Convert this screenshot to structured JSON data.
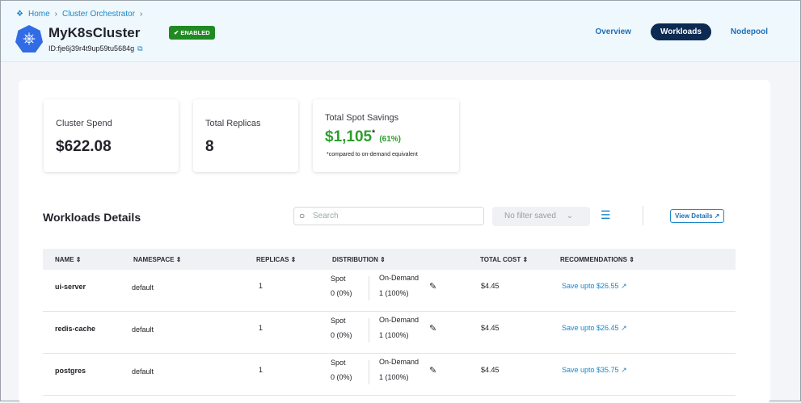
{
  "breadcrumb": {
    "home": "Home",
    "section": "Cluster Orchestrator"
  },
  "cluster": {
    "name": "MyK8sCluster",
    "id": "ID:fje6j39r4t9up59tu5684g",
    "status": "ENABLED"
  },
  "nav": [
    "Overview",
    "Workloads",
    "Nodepool"
  ],
  "stats": {
    "spend_label": "Cluster Spend",
    "spend": "$622.08",
    "replicas_label": "Total Replicas",
    "replicas": "8",
    "savings_label": "Total Spot Savings",
    "savings": "$1,105",
    "savings_mark": "*",
    "savings_pct": "(61%)",
    "savings_note": "*compared to on-demand equivalent"
  },
  "workloads": {
    "title": "Workloads Details",
    "search_placeholder": "Search",
    "filter": "No filter saved",
    "view_details": "View Details",
    "columns": [
      "NAME",
      "NAMESPACE",
      "REPLICAS",
      "DISTRIBUTION",
      "TOTAL COST",
      "RECOMMENDATIONS"
    ],
    "spot_label": "Spot",
    "ondemand_label": "On-Demand",
    "rows": [
      {
        "name": "ui-server",
        "namespace": "default",
        "replicas": "1",
        "spot": "0 (0%)",
        "ondemand": "1 (100%)",
        "cost": "$4.45",
        "rec": "Save upto $26.55"
      },
      {
        "name": "redis-cache",
        "namespace": "default",
        "replicas": "1",
        "spot": "0 (0%)",
        "ondemand": "1 (100%)",
        "cost": "$4.45",
        "rec": "Save upto $26.45"
      },
      {
        "name": "postgres",
        "namespace": "default",
        "replicas": "1",
        "spot": "0 (0%)",
        "ondemand": "1 (100%)",
        "cost": "$4.45",
        "rec": "Save upto $35.75"
      }
    ]
  }
}
